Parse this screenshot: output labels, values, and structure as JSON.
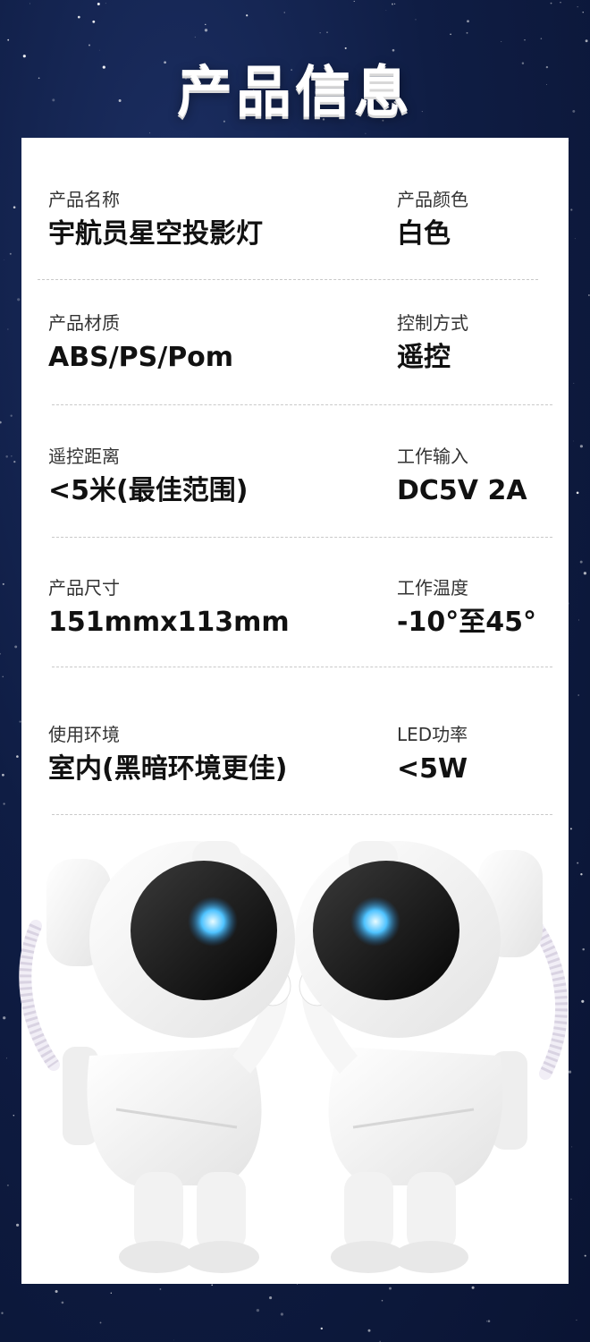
{
  "header": {
    "title": "产品信息"
  },
  "specs": [
    {
      "left": {
        "label": "产品名称",
        "value": "宇航员星空投影灯"
      },
      "right": {
        "label": "产品颜色",
        "value": "白色"
      }
    },
    {
      "left": {
        "label": "产品材质",
        "value": "ABS/PS/Pom"
      },
      "right": {
        "label": "控制方式",
        "value": "遥控"
      }
    },
    {
      "left": {
        "label": "遥控距离",
        "value": "<5米(最佳范围)"
      },
      "right": {
        "label": "工作输入",
        "value": "DC5V 2A"
      }
    },
    {
      "left": {
        "label": "产品尺寸",
        "value": "151mmx113mm"
      },
      "right": {
        "label": "工作温度",
        "value": "-10°至45°"
      }
    },
    {
      "left": {
        "label": "使用环境",
        "value": "室内(黑暗环境更佳)"
      },
      "right": {
        "label": "LED功率",
        "value": "<5W"
      }
    }
  ],
  "colors": {
    "background": "#0f1d44",
    "card": "#ffffff",
    "text": "#111111",
    "visor_glow": "#4fc3ff"
  },
  "product_image": {
    "subject": "two white astronaut star projector figures facing each other"
  }
}
